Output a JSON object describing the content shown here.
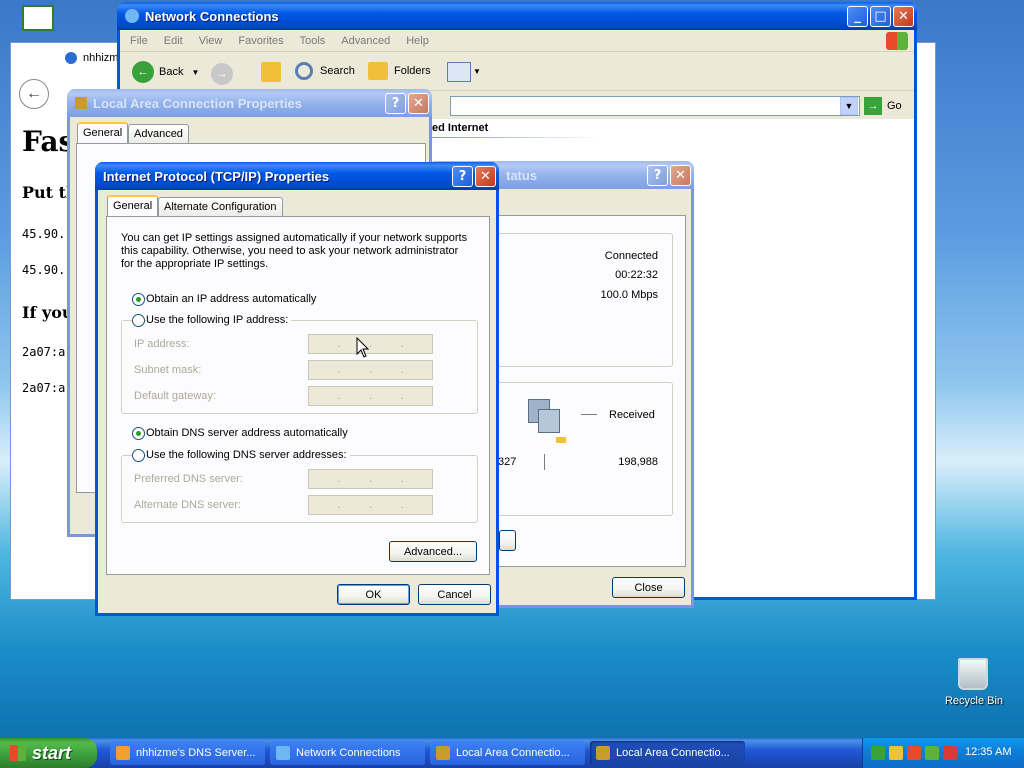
{
  "desktop": {
    "recycle_bin_label": "Recycle Bin"
  },
  "browser": {
    "tab_title": "nhhizme",
    "heading": "Fas",
    "line1": "Put th",
    "ip1": "45.90.",
    "ip2": "45.90.",
    "line2": "If you",
    "ip3": "2a07:a",
    "ip4": "2a07:a"
  },
  "network_connections": {
    "title": "Network Connections",
    "menu": [
      "File",
      "Edit",
      "View",
      "Favorites",
      "Tools",
      "Advanced",
      "Help"
    ],
    "toolbar": {
      "back": "Back",
      "search": "Search",
      "folders": "Folders"
    },
    "go_label": "Go",
    "section_fragment": "ed Internet"
  },
  "lac_properties": {
    "title": "Local Area Connection Properties",
    "tabs": [
      "General",
      "Advanced"
    ]
  },
  "status_window": {
    "title_fragment": "tatus",
    "connected": "Connected",
    "duration": "00:22:32",
    "speed": "100.0 Mbps",
    "received_label": "Received",
    "sent_fragment": "327",
    "received_value": "198,988",
    "close_label": "Close"
  },
  "tcpip": {
    "title": "Internet Protocol (TCP/IP) Properties",
    "tabs": [
      "General",
      "Alternate Configuration"
    ],
    "intro": "You can get IP settings assigned automatically if your network supports this capability. Otherwise, you need to ask your network administrator for the appropriate IP settings.",
    "obtain_ip_auto": "Obtain an IP address automatically",
    "use_following_ip": "Use the following IP address:",
    "ip_address_label": "IP address:",
    "subnet_mask_label": "Subnet mask:",
    "default_gateway_label": "Default gateway:",
    "obtain_dns_auto": "Obtain DNS server address automatically",
    "use_following_dns": "Use the following DNS server addresses:",
    "preferred_dns_label": "Preferred DNS server:",
    "alternate_dns_label": "Alternate DNS server:",
    "advanced_button": "Advanced...",
    "ok_button": "OK",
    "cancel_button": "Cancel",
    "ip_selected": "auto",
    "dns_selected": "auto"
  },
  "taskbar": {
    "start": "start",
    "items": [
      "nhhizme's DNS Server...",
      "Network Connections",
      "Local Area Connectio...",
      "Local Area Connectio..."
    ],
    "clock": "12:35 AM"
  },
  "colors": {
    "xp_blue": "#0054e3",
    "dialog_bg": "#ece9d8",
    "radio_dot": "#21a121"
  }
}
